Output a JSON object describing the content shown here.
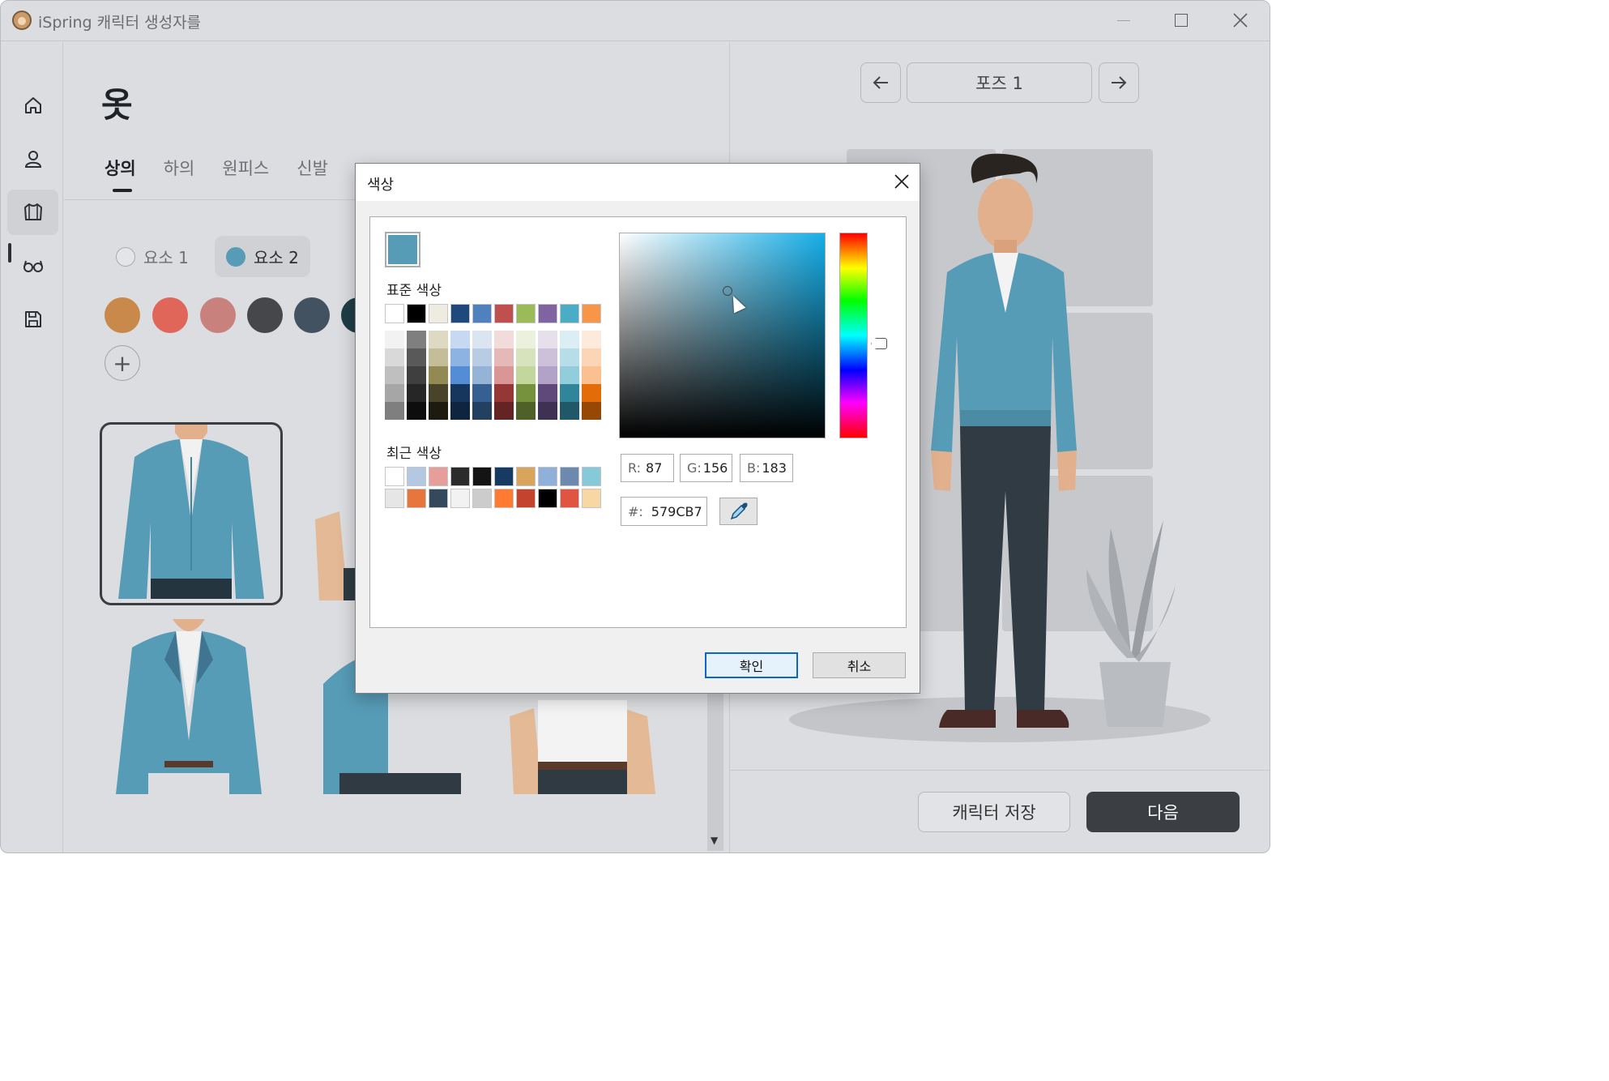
{
  "window": {
    "title": "iSpring 캐릭터 생성자를"
  },
  "sidebar": {
    "items": [
      {
        "name": "home-icon"
      },
      {
        "name": "person-icon"
      },
      {
        "name": "clothes-icon",
        "active": true
      },
      {
        "name": "glasses-icon"
      },
      {
        "name": "save-icon"
      }
    ]
  },
  "main": {
    "title": "옷",
    "tabs": [
      {
        "label": "상의",
        "active": true
      },
      {
        "label": "하의"
      },
      {
        "label": "원피스"
      },
      {
        "label": "신발"
      }
    ],
    "elements": [
      {
        "label": "요소 1",
        "active": false
      },
      {
        "label": "요소 2",
        "active": true,
        "color": "#579CB7"
      }
    ],
    "swatches": [
      "#c8894a",
      "#e0665a",
      "#c8817d",
      "#45474b",
      "#435260",
      "#1f3d45"
    ],
    "add_label": "+"
  },
  "right": {
    "pose_label": "포즈 1",
    "save_label": "캐릭터 저장",
    "next_label": "다음"
  },
  "dialog": {
    "title": "색상",
    "current_color": "#579CB7",
    "standard_label": "표준 색상",
    "standard_colors": [
      "#ffffff",
      "#000000",
      "#eeece1",
      "#1f497d",
      "#4f81bd",
      "#c0504d",
      "#9bbb59",
      "#8064a2",
      "#4bacc6",
      "#f79646"
    ],
    "shade_columns": [
      [
        "#f2f2f2",
        "#d9d9d9",
        "#bfbfbf",
        "#a6a6a6",
        "#7f7f7f"
      ],
      [
        "#7f7f7f",
        "#595959",
        "#3f3f3f",
        "#262626",
        "#0d0d0d"
      ],
      [
        "#ddd9c3",
        "#c4bd97",
        "#938953",
        "#494429",
        "#1d1b10"
      ],
      [
        "#c6d9f0",
        "#8db3e2",
        "#548dd4",
        "#17365d",
        "#0f243e"
      ],
      [
        "#dbe5f1",
        "#b8cce4",
        "#95b3d7",
        "#366092",
        "#244061"
      ],
      [
        "#f2dcdb",
        "#e5b9b7",
        "#d99694",
        "#953734",
        "#632423"
      ],
      [
        "#ebf1dd",
        "#d7e3bc",
        "#c3d69b",
        "#76923c",
        "#4f6128"
      ],
      [
        "#e5e0ec",
        "#ccc1d9",
        "#b2a2c7",
        "#5f497a",
        "#3f3151"
      ],
      [
        "#dbeef3",
        "#b7dde8",
        "#92cddc",
        "#31859b",
        "#205867"
      ],
      [
        "#fdeada",
        "#fbd5b5",
        "#fac08f",
        "#e36c09",
        "#974806"
      ]
    ],
    "recent_label": "최근 색상",
    "recent_row1": [
      "#ffffff",
      "#b4c8e1",
      "#e59e9a",
      "#2b2b2b",
      "#141414",
      "#163b63",
      "#d9a45b",
      "#8fb0d9",
      "#6d89ad",
      "#86c9d9"
    ],
    "recent_row2": [
      "#e6e6e6",
      "#e8763c",
      "#344a5c",
      "#f2f2f2",
      "#cccccc",
      "#ff7a33",
      "#c4432c",
      "#000000",
      "#e05542",
      "#f8d7a4"
    ],
    "r_label": "R:",
    "r_value": "87",
    "g_label": "G:",
    "g_value": "156",
    "b_label": "B:",
    "b_value": "183",
    "hex_label": "#:",
    "hex_value": "579CB7",
    "ok_label": "확인",
    "cancel_label": "취소"
  }
}
